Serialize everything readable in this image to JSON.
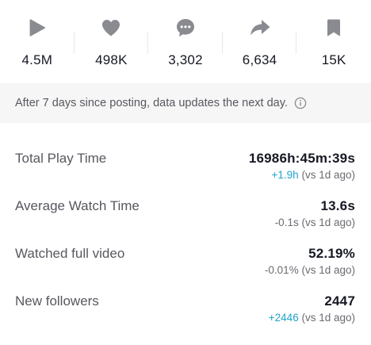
{
  "stats": [
    {
      "icon": "play-icon",
      "value": "4.5M"
    },
    {
      "icon": "heart-icon",
      "value": "498K"
    },
    {
      "icon": "comment-icon",
      "value": "3,302"
    },
    {
      "icon": "share-icon",
      "value": "6,634"
    },
    {
      "icon": "bookmark-icon",
      "value": "15K"
    }
  ],
  "banner": {
    "text": "After 7 days since posting, data updates the next day."
  },
  "metrics": [
    {
      "label": "Total Play Time",
      "value": "16986h:45m:39s",
      "delta": "+1.9h",
      "comparison": " (vs 1d ago)"
    },
    {
      "label": "Average Watch Time",
      "value": "13.6s",
      "delta": "-0.1s",
      "comparison": " (vs 1d ago)"
    },
    {
      "label": "Watched full video",
      "value": "52.19%",
      "delta": "-0.01%",
      "comparison": " (vs 1d ago)"
    },
    {
      "label": "New followers",
      "value": "2447",
      "delta": "+2446",
      "comparison": " (vs 1d ago)"
    }
  ],
  "colors": {
    "icon_gray": "#8a8b91",
    "text_primary": "#161823",
    "text_secondary": "#57585f",
    "delta_positive": "#20a5c9",
    "banner_bg": "#f6f6f6"
  }
}
